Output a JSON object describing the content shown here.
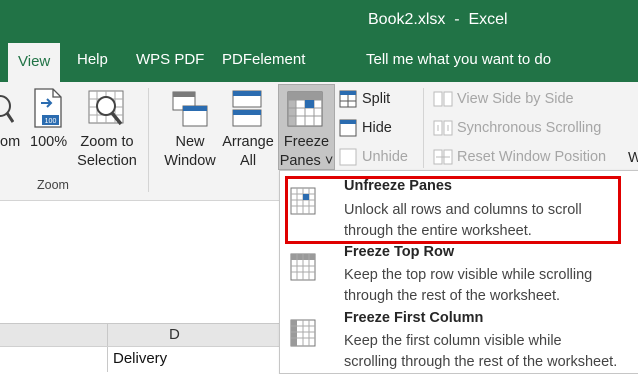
{
  "window": {
    "title": "Book2.xlsx  -  Excel"
  },
  "tabs": [
    {
      "label": "View",
      "active": true
    },
    {
      "label": "Help"
    },
    {
      "label": "WPS PDF"
    },
    {
      "label": "PDFelement"
    },
    {
      "label": "Tell me what you want to do"
    }
  ],
  "ribbon": {
    "zoom_partial": "om",
    "zoom100": "100%",
    "zoom_to_selection": [
      "Zoom to",
      "Selection"
    ],
    "zoom_group": "Zoom",
    "new_window": [
      "New",
      "Window"
    ],
    "arrange_all": [
      "Arrange",
      "All"
    ],
    "freeze_panes": [
      "Freeze",
      "Panes ˅"
    ],
    "split": "Split",
    "hide": "Hide",
    "unhide": "Unhide",
    "view_side_by_side": "View Side by Side",
    "sync_scrolling": "Synchronous Scrolling",
    "reset_window": "Reset Window Position",
    "cut_w": "W"
  },
  "menu": [
    {
      "title": "Unfreeze Panes",
      "desc": [
        "Unlock all rows and columns to scroll",
        "through the entire worksheet."
      ]
    },
    {
      "title": "Freeze Top Row",
      "desc": [
        "Keep the top row visible while scrolling",
        "through the rest of the worksheet."
      ]
    },
    {
      "title": "Freeze First Column",
      "desc": [
        "Keep the first column visible while",
        "scrolling through the rest of the worksheet."
      ]
    }
  ],
  "sheet": {
    "column_d": "D",
    "cell_d": "Delivery"
  },
  "colors": {
    "excel_green": "#217346",
    "highlight": "#e00000"
  }
}
